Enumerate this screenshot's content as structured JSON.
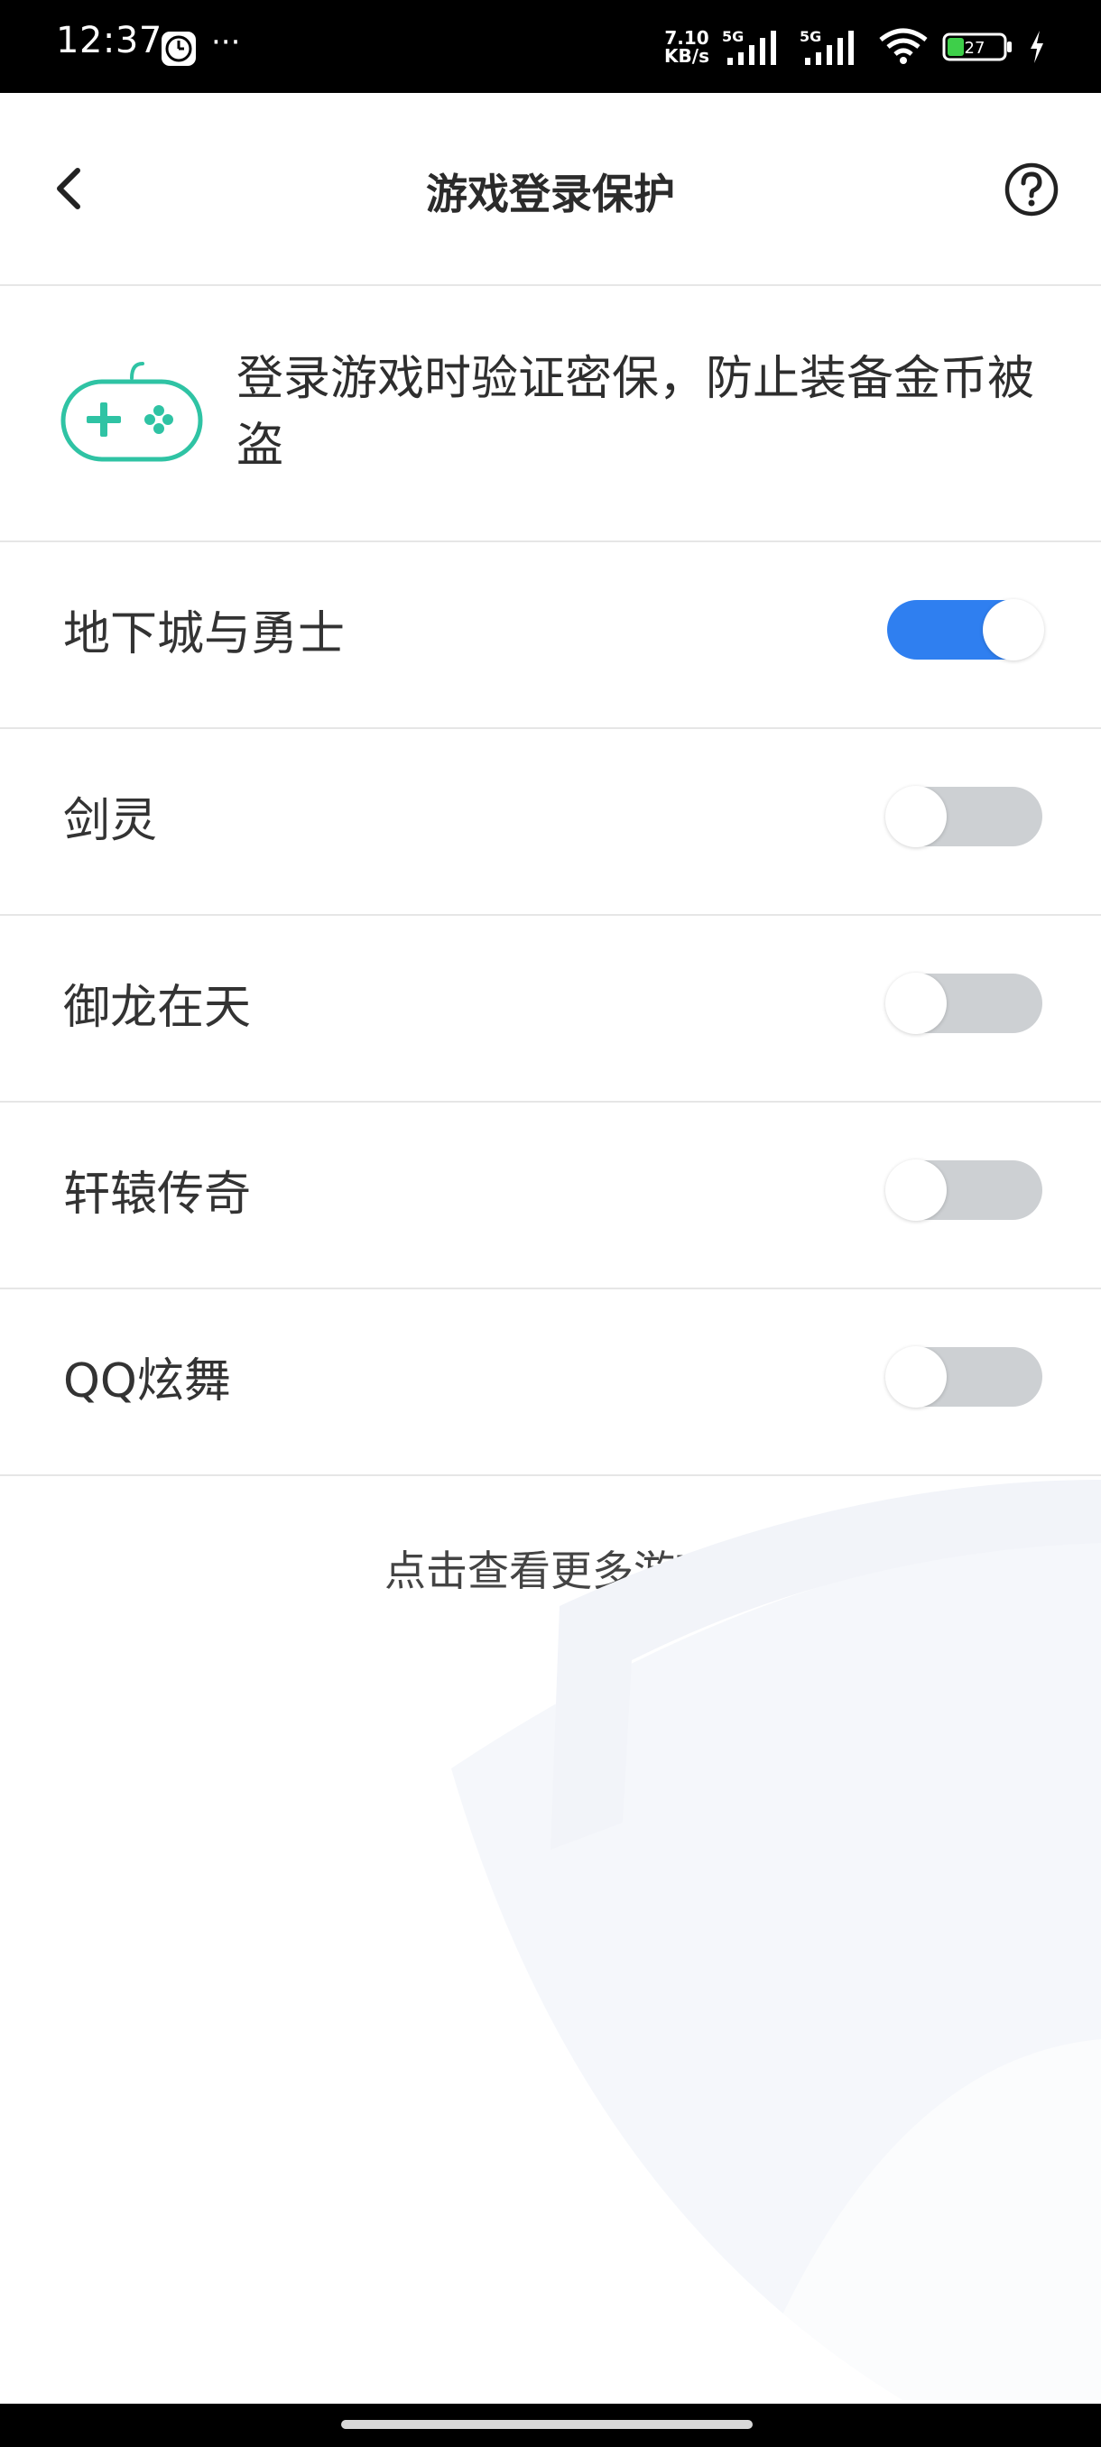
{
  "status_bar": {
    "time": "12:37",
    "more": "···",
    "net_speed_value": "7.10",
    "net_speed_unit": "KB/s",
    "signal1_label": "5G",
    "signal2_label": "5G",
    "battery": "27"
  },
  "header": {
    "title": "游戏登录保护"
  },
  "intro": {
    "text": "登录游戏时验证密保，防止装备金币被盗",
    "icon_color": "#2fc3a4"
  },
  "games": [
    {
      "name": "地下城与勇士",
      "enabled": true
    },
    {
      "name": "剑灵",
      "enabled": false
    },
    {
      "name": "御龙在天",
      "enabled": false
    },
    {
      "name": "轩辕传奇",
      "enabled": false
    },
    {
      "name": "QQ炫舞",
      "enabled": false
    }
  ],
  "more_games_label": "点击查看更多游戏",
  "colors": {
    "toggle_on": "#2f7ff0",
    "toggle_off": "#cdd0d3",
    "accent_teal": "#2fc3a4"
  }
}
